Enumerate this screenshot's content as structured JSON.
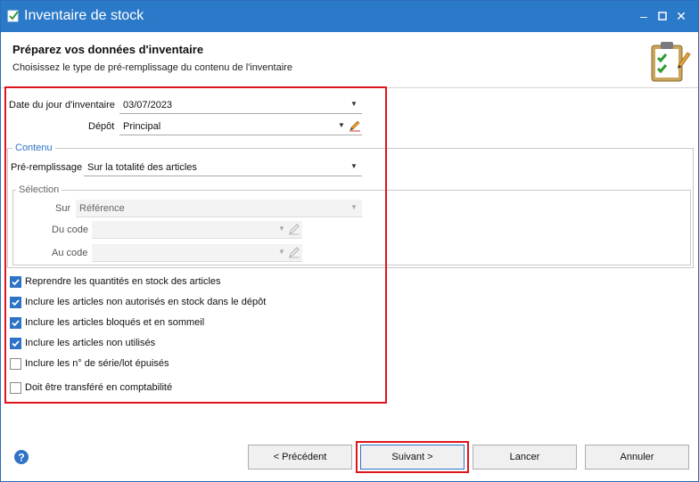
{
  "window": {
    "title": "Inventaire de stock"
  },
  "header": {
    "title": "Préparez vos données d'inventaire",
    "subtitle": "Choisissez le type de pré-remplissage du contenu de l'inventaire"
  },
  "form": {
    "date_label": "Date du jour d'inventaire",
    "date_value": "03/07/2023",
    "depot_label": "Dépôt",
    "depot_value": "Principal",
    "contenu_legend": "Contenu",
    "preremplissage_label": "Pré-remplissage",
    "preremplissage_value": "Sur la totalité des articles",
    "selection_legend": "Sélection",
    "sur_label": "Sur",
    "sur_value": "Référence",
    "ducode_label": "Du code",
    "ducode_value": "",
    "aucode_label": "Au code",
    "aucode_value": ""
  },
  "options": [
    {
      "label": "Reprendre les quantités en stock des articles",
      "checked": true
    },
    {
      "label": "Inclure les articles non autorisés en stock dans le dépôt",
      "checked": true
    },
    {
      "label": "Inclure les articles bloqués et en sommeil",
      "checked": true
    },
    {
      "label": "Inclure les articles non utilisés",
      "checked": true
    },
    {
      "label": "Inclure les n° de série/lot épuisés",
      "checked": false
    },
    {
      "label": "Doit être transféré en comptabilité",
      "checked": false
    }
  ],
  "footer": {
    "prev_label": "< Précédent",
    "next_label": "Suivant >",
    "launch_label": "Lancer",
    "cancel_label": "Annuler"
  },
  "colors": {
    "titlebar": "#2b79c9",
    "accent": "#2e73c6",
    "highlight": "#e0141b"
  },
  "icons": [
    "app-icon",
    "minimize-icon",
    "maximize-icon",
    "close-icon",
    "clipboard-check-icon",
    "dropdown-arrow-icon",
    "pencil-edit-icon",
    "help-icon",
    "checkmark-icon"
  ]
}
